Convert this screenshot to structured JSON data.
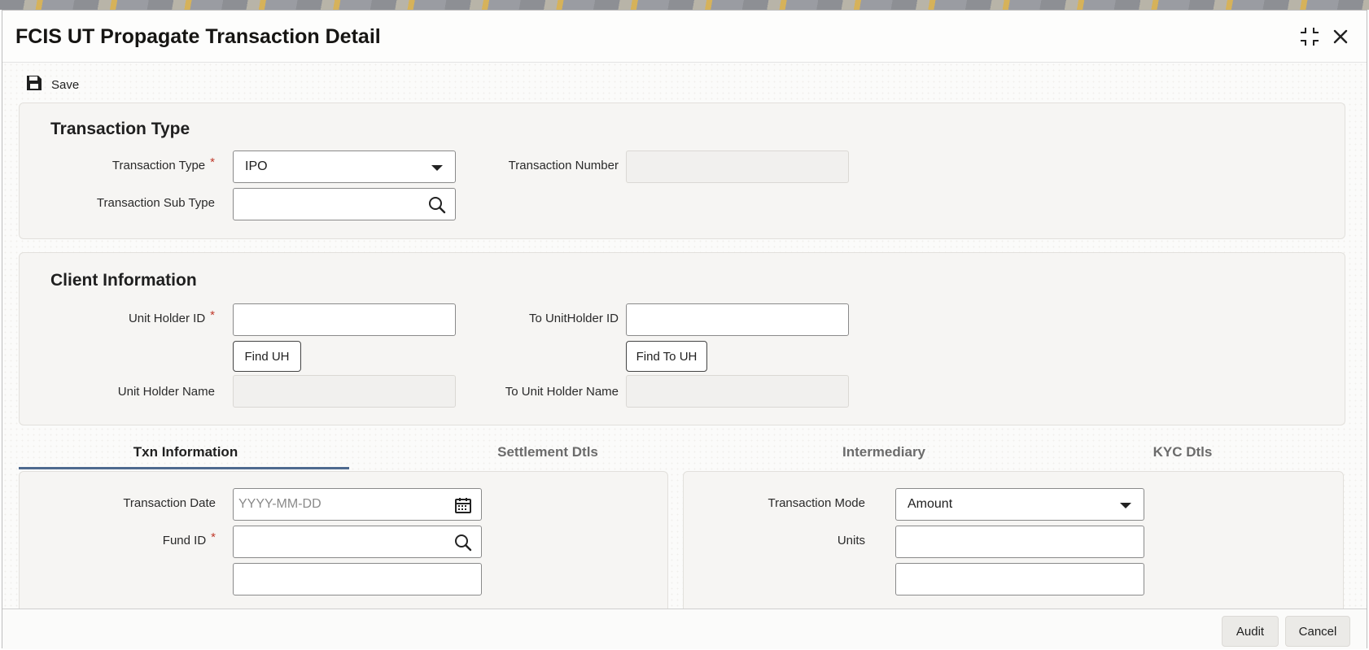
{
  "window": {
    "title": "FCIS UT Propagate Transaction Detail"
  },
  "toolbar": {
    "save_label": "Save"
  },
  "transaction_type_section": {
    "heading": "Transaction Type",
    "transaction_type_label": "Transaction Type",
    "transaction_type_value": "IPO",
    "transaction_number_label": "Transaction Number",
    "transaction_number_value": "",
    "transaction_sub_type_label": "Transaction Sub Type",
    "transaction_sub_type_value": ""
  },
  "client_information_section": {
    "heading": "Client Information",
    "unit_holder_id_label": "Unit Holder ID",
    "unit_holder_id_value": "",
    "find_uh_label": "Find UH",
    "to_unitholder_id_label": "To UnitHolder ID",
    "to_unitholder_id_value": "",
    "find_to_uh_label": "Find To UH",
    "unit_holder_name_label": "Unit Holder Name",
    "to_unit_holder_name_label": "To Unit Holder Name"
  },
  "tabs": [
    {
      "label": "Txn Information",
      "active": true
    },
    {
      "label": "Settlement Dtls",
      "active": false
    },
    {
      "label": "Intermediary",
      "active": false
    },
    {
      "label": "KYC Dtls",
      "active": false
    }
  ],
  "txn_information": {
    "transaction_date_label": "Transaction Date",
    "transaction_date_placeholder": "YYYY-MM-DD",
    "fund_id_label": "Fund ID",
    "transaction_mode_label": "Transaction Mode",
    "transaction_mode_value": "Amount",
    "units_label": "Units"
  },
  "required_marker": "*",
  "footer": {
    "audit_label": "Audit",
    "cancel_label": "Cancel"
  },
  "colors": {
    "accent_tab_underline": "#4e6a8f",
    "required": "#c0392b",
    "panel_bg": "#f6f5f3"
  },
  "icons": [
    "save-icon",
    "expand-icon",
    "close-icon",
    "caret-down-icon",
    "search-icon",
    "calendar-icon"
  ]
}
